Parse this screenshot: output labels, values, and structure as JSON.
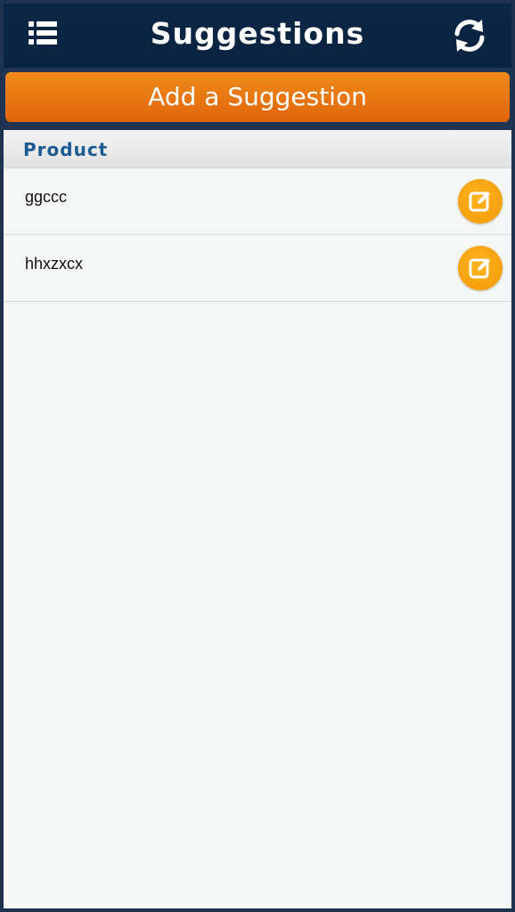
{
  "header": {
    "title": "Suggestions",
    "menu_icon": "list-menu-icon",
    "refresh_icon": "refresh-icon"
  },
  "add_button": {
    "label": "Add a Suggestion"
  },
  "section": {
    "title": "Product"
  },
  "items": [
    {
      "label": "ggccc",
      "action_icon": "edit-icon"
    },
    {
      "label": "hhxzxcx",
      "action_icon": "edit-icon"
    }
  ],
  "colors": {
    "header_bg": "#0b2645",
    "accent_orange": "#e8760f",
    "edit_button": "#f5a312",
    "section_text": "#1d5a92"
  }
}
